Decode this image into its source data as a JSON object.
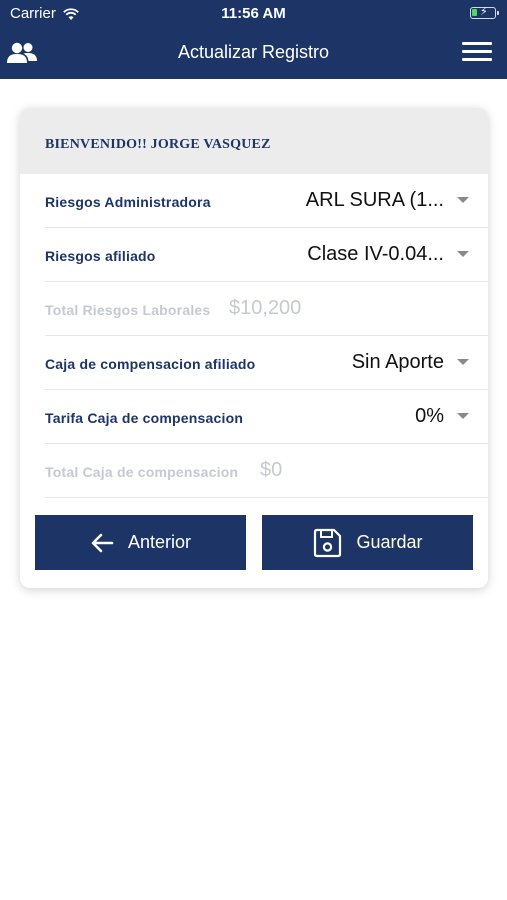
{
  "status_bar": {
    "carrier": "Carrier",
    "time": "11:56 AM"
  },
  "header": {
    "title": "Actualizar Registro",
    "left_icon": "users-icon",
    "right_icon": "hamburger-menu-icon"
  },
  "card": {
    "welcome": "BIENVENIDO!! JORGE VASQUEZ",
    "fields": {
      "riesgos_admin": {
        "label": "Riesgos Administradora",
        "value": "ARL SURA (1..."
      },
      "riesgos_afiliado": {
        "label": "Riesgos afiliado",
        "value": "Clase IV-0.04..."
      },
      "total_riesgos": {
        "label": "Total Riesgos Laborales",
        "value": "$10,200"
      },
      "caja_afiliado": {
        "label": "Caja de compensacion afiliado",
        "value": "Sin Aporte"
      },
      "tarifa_caja": {
        "label": "Tarifa Caja de compensacion",
        "value": "0%"
      },
      "total_caja": {
        "label": "Total Caja de compensacion",
        "value": "$0"
      }
    },
    "buttons": {
      "previous": "Anterior",
      "save": "Guardar"
    }
  },
  "colors": {
    "primary": "#1c3566",
    "header_bg": "#ececec",
    "muted": "#c6c9d0"
  }
}
